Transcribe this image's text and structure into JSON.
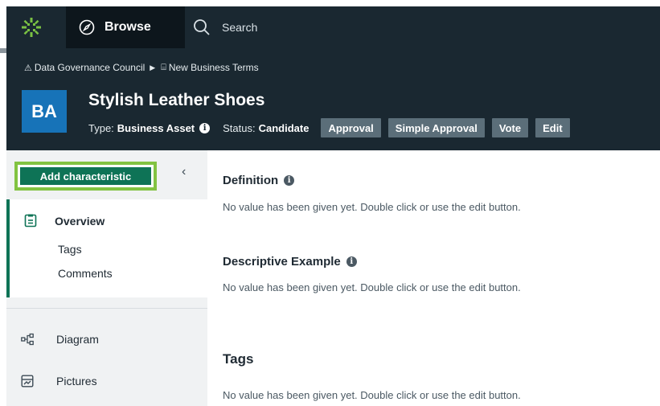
{
  "topbar": {
    "logo_icon": "collibra-logo-icon",
    "browse_label": "Browse",
    "search_placeholder": "Search"
  },
  "breadcrumb": {
    "items": [
      {
        "icon": "community-icon",
        "label": "Data Governance Council"
      },
      {
        "icon": "glossary-icon",
        "label": "New Business Terms"
      }
    ]
  },
  "asset": {
    "badge": "BA",
    "title": "Stylish Leather Shoes",
    "type_label": "Type:",
    "type_value": "Business Asset",
    "status_label": "Status:",
    "status_value": "Candidate",
    "workflows": [
      "Approval",
      "Simple Approval",
      "Vote",
      "Edit"
    ]
  },
  "sidebar": {
    "add_characteristic": "Add characteristic",
    "overview": "Overview",
    "overview_subs": [
      "Tags",
      "Comments"
    ],
    "items": [
      {
        "icon": "diagram-icon",
        "label": "Diagram"
      },
      {
        "icon": "pictures-icon",
        "label": "Pictures"
      }
    ]
  },
  "main": {
    "sections": [
      {
        "title": "Definition",
        "text": "No value has been given yet. Double click or use the edit button."
      },
      {
        "title": "Descriptive Example",
        "text": "No value has been given yet. Double click or use the edit button."
      },
      {
        "title": "Tags",
        "text": "No value has been given yet. Double click or use the edit button."
      }
    ]
  },
  "colors": {
    "header_bg": "#1a2831",
    "badge_blue": "#1773b8",
    "primary_green": "#0e7356",
    "highlight_lime": "#82c341",
    "workflow_btn": "#5b6e79"
  }
}
